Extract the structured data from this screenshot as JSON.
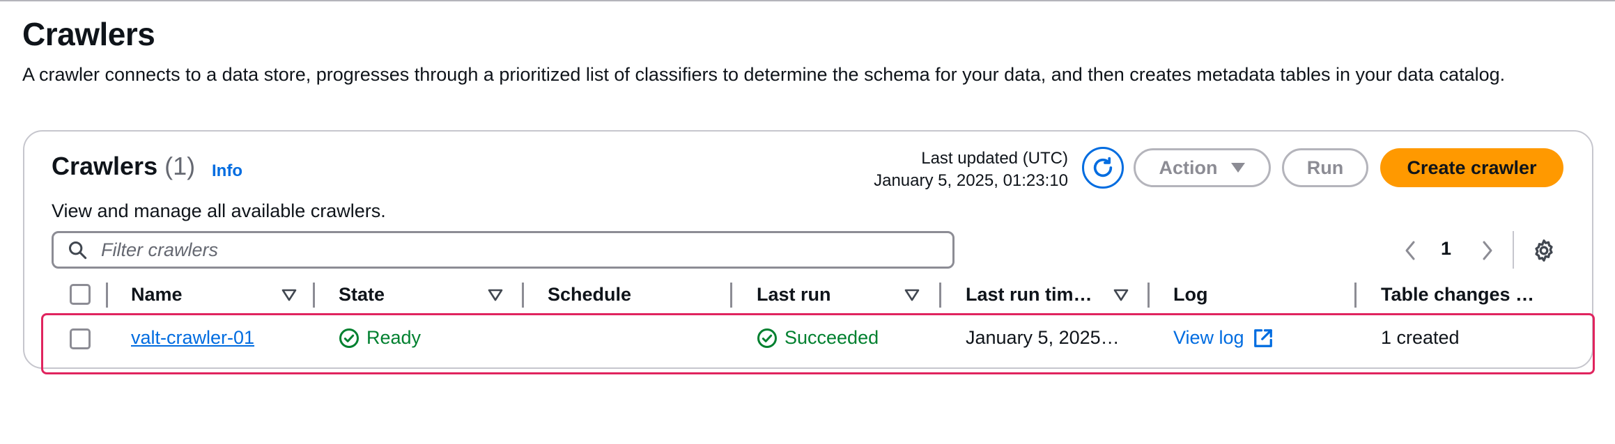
{
  "page": {
    "title": "Crawlers",
    "description": "A crawler connects to a data store, progresses through a prioritized list of classifiers to determine the schema for your data, and then creates metadata tables in your data catalog."
  },
  "card": {
    "title": "Crawlers",
    "count": "(1)",
    "info_label": "Info",
    "description": "View and manage all available crawlers.",
    "last_updated_label": "Last updated (UTC)",
    "last_updated_value": "January 5, 2025, 01:23:10",
    "refresh_icon": "refresh-icon",
    "buttons": {
      "action": "Action",
      "run": "Run",
      "create": "Create crawler"
    },
    "search": {
      "placeholder": "Filter crawlers",
      "value": ""
    },
    "pagination": {
      "current_page": "1"
    }
  },
  "table": {
    "columns": [
      "Name",
      "State",
      "Schedule",
      "Last run",
      "Last run tim…",
      "Log",
      "Table changes …"
    ],
    "rows": [
      {
        "name": "valt-crawler-01",
        "state": "Ready",
        "schedule": "",
        "last_run": "Succeeded",
        "last_run_time": "January 5, 2025…",
        "log": "View log",
        "table_changes": "1 created"
      }
    ]
  },
  "colors": {
    "accent": "#006ce0",
    "primary_button": "#ff9900",
    "success": "#00802f",
    "highlight": "#e0245e"
  }
}
